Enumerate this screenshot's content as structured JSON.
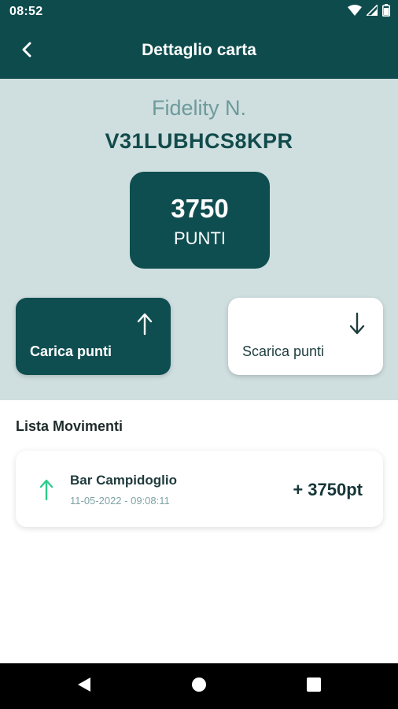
{
  "status_bar": {
    "time": "08:52",
    "icons": [
      "wifi-icon",
      "signal-icon",
      "battery-icon"
    ]
  },
  "app_bar": {
    "title": "Dettaglio carta",
    "back_icon": "chevron-left-icon"
  },
  "card": {
    "label": "Fidelity N.",
    "code": "V31LUBHCS8KPR",
    "points_value": "3750",
    "points_unit": "PUNTI"
  },
  "actions": [
    {
      "label": "Carica punti",
      "icon": "arrow-up-icon"
    },
    {
      "label": "Scarica punti",
      "icon": "arrow-down-icon"
    }
  ],
  "movements": {
    "title": "Lista Movimenti",
    "items": [
      {
        "name": "Bar Campidoglio",
        "date": "11-05-2022 - 09:08:11",
        "amount": "+ 3750pt",
        "icon": "arrow-up-icon"
      }
    ]
  },
  "nav_bar": {
    "buttons": [
      "back-triangle-icon",
      "home-circle-icon",
      "recents-square-icon"
    ]
  },
  "colors": {
    "primary": "#0e4b4d",
    "hero_bg": "#cfdedf",
    "accent_green": "#2ecc8a",
    "muted_teal": "#6d9a9b"
  }
}
